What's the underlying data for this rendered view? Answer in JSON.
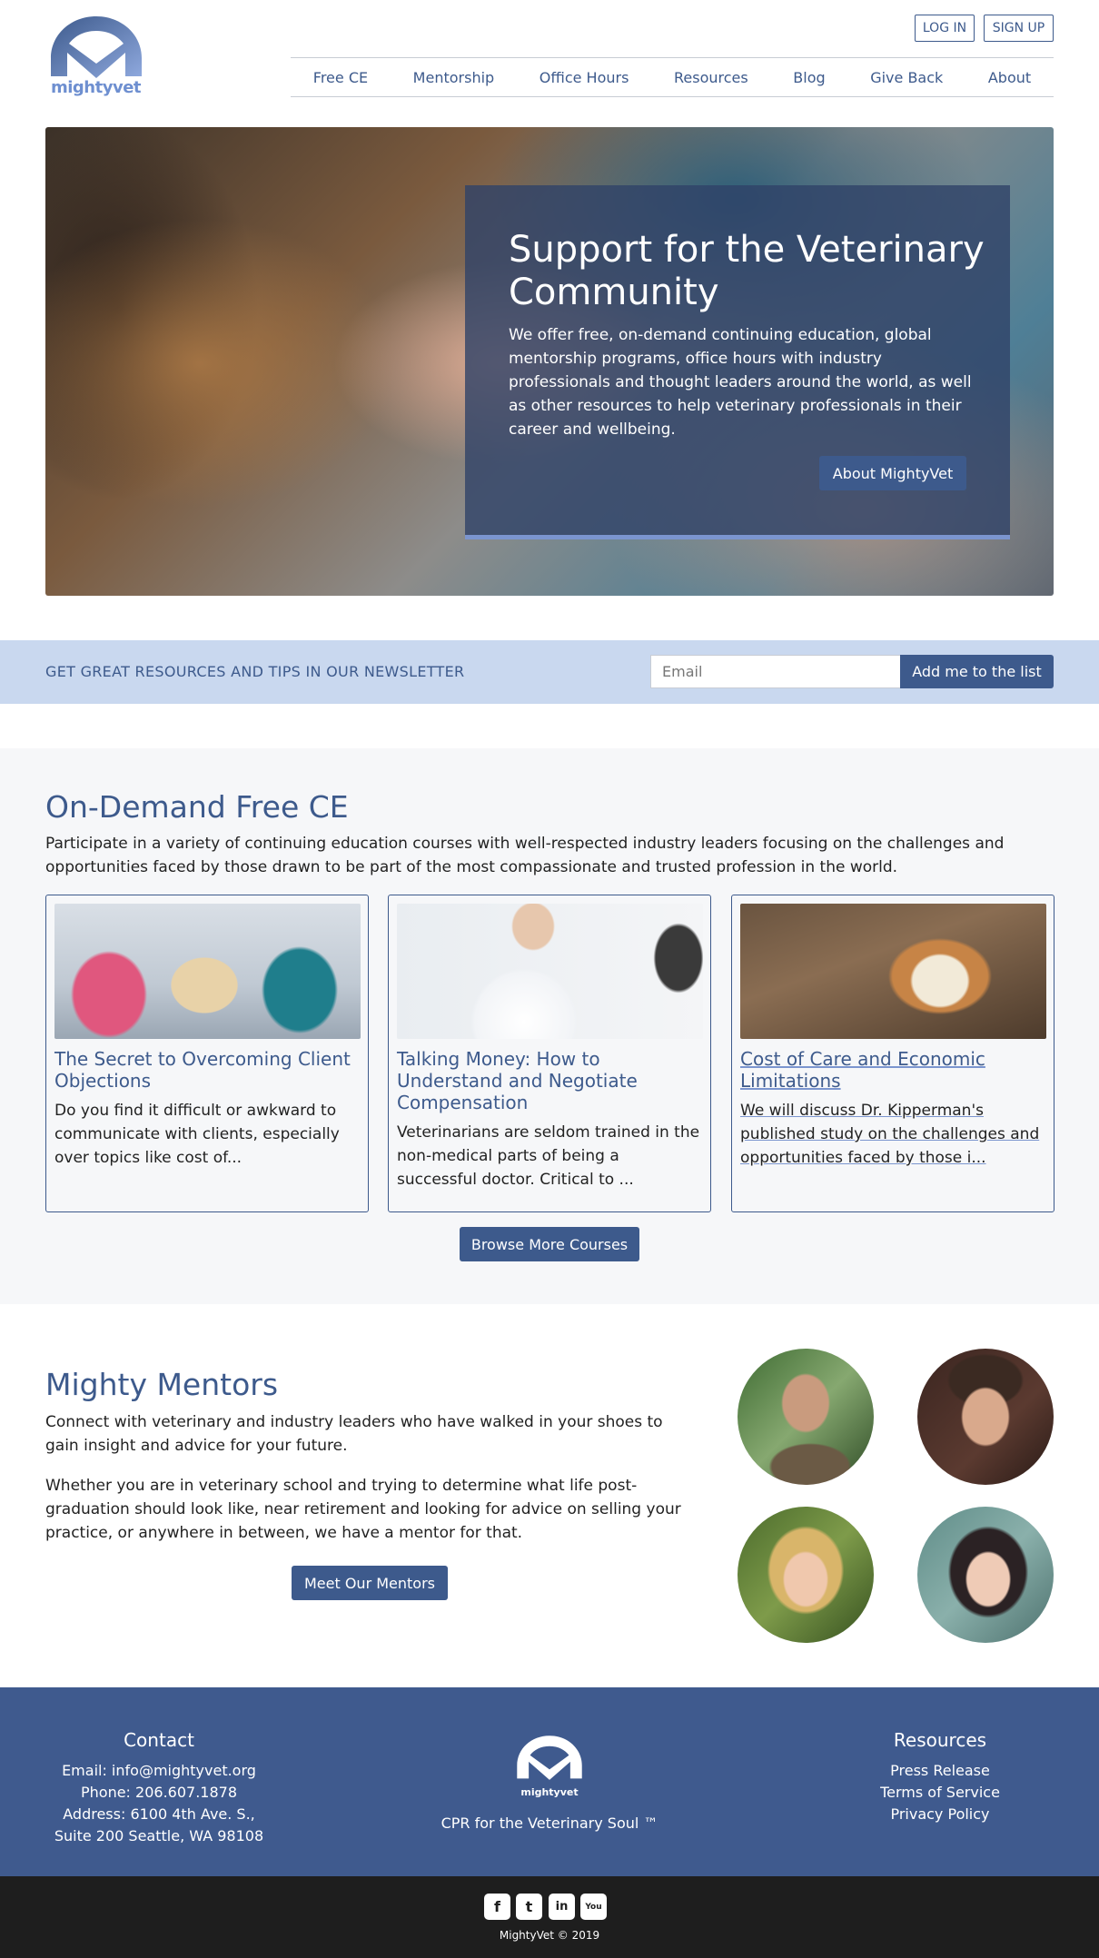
{
  "brand": {
    "name": "mightyvet",
    "accent": "#3d5a8c",
    "light_accent": "#7b95cf",
    "newsletter_bg": "#c9d8ef",
    "footer_bg": "#3f5a8e"
  },
  "auth": {
    "login": "LOG IN",
    "signup": "SIGN UP"
  },
  "nav": [
    "Free CE",
    "Mentorship",
    "Office Hours",
    "Resources",
    "Blog",
    "Give Back",
    "About"
  ],
  "hero": {
    "title": "Support for the Veterinary Community",
    "text": "We offer free, on-demand continuing education, global mentorship programs, office hours with industry professionals and thought leaders around the world, as well as other resources to help veterinary professionals in their career and wellbeing.",
    "button": "About MightyVet"
  },
  "newsletter": {
    "label": "GET GREAT RESOURCES AND TIPS IN OUR NEWSLETTER",
    "placeholder": "Email",
    "button": "Add me to the list"
  },
  "ce": {
    "title": "On-Demand Free CE",
    "description": "Participate in a variety of continuing education courses with well-respected industry leaders focusing on the challenges and opportunities faced by those drawn to be part of the most compassionate and trusted profession in the world.",
    "cards": [
      {
        "title": "The Secret to Overcoming Client Objections",
        "text": "Do you find it difficult or awkward to communicate with clients, especially over topics like cost of..."
      },
      {
        "title": "Talking Money: How to Understand and Negotiate Compensation",
        "text": "Veterinarians are seldom trained in the non-medical parts of being a successful doctor. Critical to ..."
      },
      {
        "title": "Cost of Care and Economic Limitations",
        "text": "We will discuss Dr. Kipperman's published study on the challenges and opportunities faced by those i..."
      }
    ],
    "browse_button": "Browse More Courses"
  },
  "mentors": {
    "title": "Mighty Mentors",
    "p1": "Connect with veterinary and industry leaders who have walked in your shoes to gain insight and advice for your future.",
    "p2": "Whether you are in veterinary school and trying to determine what life post-graduation should look like, near retirement and looking for advice on selling your practice, or anywhere in between, we have a mentor for that.",
    "button": "Meet Our Mentors"
  },
  "footer": {
    "contact": {
      "heading": "Contact",
      "email": "Email:  info@mightyvet.org",
      "phone": "Phone:  206.607.1878",
      "address1": "Address:  6100 4th Ave. S.,",
      "address2": "Suite 200 Seattle, WA 98108"
    },
    "tagline": "CPR for the Veterinary Soul ™",
    "resources": {
      "heading": "Resources",
      "links": [
        "Press Release",
        "Terms of Service",
        "Privacy Policy"
      ]
    },
    "social_icons": [
      "facebook-icon",
      "twitter-icon",
      "linkedin-icon",
      "youtube-icon"
    ],
    "social_glyphs": [
      "f",
      "t",
      "in",
      "You"
    ],
    "copyright": "MightyVet © 2019"
  }
}
